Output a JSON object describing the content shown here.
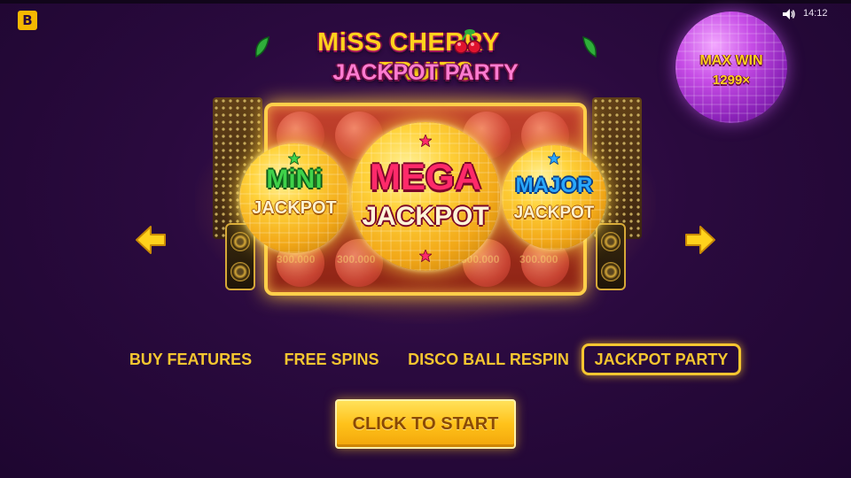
{
  "header": {
    "brand_letter": "B",
    "time": "14:12",
    "icons": {
      "brand": "brand-logo",
      "sound": "speaker-icon"
    }
  },
  "title": {
    "line1": "MiSS CHERRY",
    "line1b": "FRUITS",
    "line2": "JACKPOT PARTY"
  },
  "max_win": {
    "label": "MAX WIN",
    "value": "1299×"
  },
  "jackpots": {
    "mini": {
      "word": "MiNi",
      "label": "JACKPOT",
      "color": "#3fd24a"
    },
    "mega": {
      "word": "MEGA",
      "label": "JACKPOT",
      "color": "#ff2a6a"
    },
    "major": {
      "word": "MAJOR",
      "label": "JACKPOT",
      "color": "#29a8ff"
    }
  },
  "reel_amounts": [
    "300.000",
    "300.000",
    "300.000",
    "300.000"
  ],
  "tabs": [
    {
      "label": "BUY FEATURES",
      "active": false
    },
    {
      "label": "FREE SPINS",
      "active": false
    },
    {
      "label": "DISCO BALL RESPIN",
      "active": false
    },
    {
      "label": "JACKPOT PARTY",
      "active": true
    }
  ],
  "start_button": {
    "label": "CLICK TO START"
  },
  "colors": {
    "background": "#2a0a3e",
    "accent_gold": "#f5c630",
    "title_pink": "#ff7bd0"
  }
}
